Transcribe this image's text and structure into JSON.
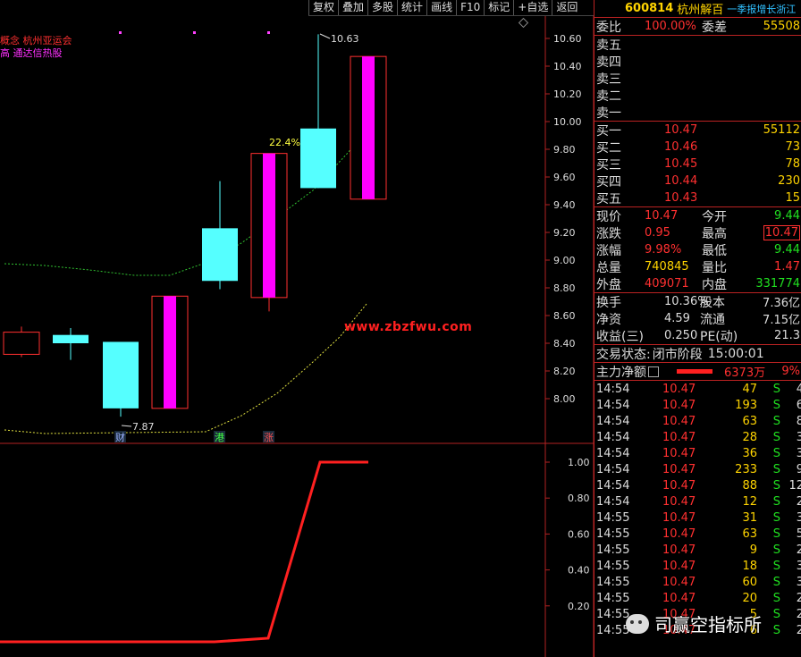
{
  "toolbar": [
    "复权",
    "叠加",
    "多股",
    "统计",
    "画线",
    "F10",
    "标记",
    "+自选",
    "返回"
  ],
  "concepts": [
    {
      "text": "概念 杭州亚运会",
      "color": "#ff3030"
    },
    {
      "text": "高 通达信热股",
      "color": "#ff30ff"
    }
  ],
  "chart_data": {
    "type": "candlestick",
    "y_ticks": [
      "10.60",
      "10.40",
      "10.20",
      "10.00",
      "9.80",
      "9.60",
      "9.40",
      "9.20",
      "9.00",
      "8.80",
      "8.60",
      "8.40",
      "8.20",
      "8.00"
    ],
    "candles": [
      {
        "open": 8.32,
        "close": 8.48,
        "high": 8.52,
        "low": 8.3,
        "color": "#ff3030",
        "fill": "none"
      },
      {
        "open": 8.46,
        "close": 8.4,
        "high": 8.51,
        "low": 8.28,
        "color": "#55ffff",
        "fill": "#55ffff"
      },
      {
        "open": 8.41,
        "close": 7.93,
        "high": 8.41,
        "low": 7.87,
        "color": "#55ffff",
        "fill": "#55ffff"
      },
      {
        "open": 7.93,
        "close": 8.74,
        "high": 8.74,
        "low": 7.93,
        "color": "#ff3030",
        "fill": "#ff00ff"
      },
      {
        "open": 9.23,
        "close": 8.85,
        "high": 9.57,
        "low": 8.79,
        "color": "#55ffff",
        "fill": "#55ffff"
      },
      {
        "open": 8.73,
        "close": 9.77,
        "high": 9.77,
        "low": 8.63,
        "color": "#ff3030",
        "fill": "#ff00ff"
      },
      {
        "open": 9.95,
        "close": 9.52,
        "high": 10.63,
        "low": 9.52,
        "color": "#55ffff",
        "fill": "#55ffff"
      },
      {
        "open": 9.44,
        "close": 10.47,
        "high": 10.47,
        "low": 9.44,
        "color": "#ff3030",
        "fill": "#ff00ff"
      }
    ],
    "annotations": {
      "high": "10.63",
      "low": "7.87",
      "pct": "22.4%"
    },
    "markers": [
      {
        "text": "财",
        "color": "#9ab0ff"
      },
      {
        "text": "港",
        "color": "#40ff40"
      },
      {
        "text": "涨",
        "color": "#ff5050"
      }
    ],
    "lower_y_ticks": [
      "1.00",
      "0.80",
      "0.60",
      "0.40",
      "0.20"
    ],
    "lower_line": [
      0,
      0,
      0,
      0,
      0,
      0.02,
      1,
      1
    ]
  },
  "watermark": "www.zbzfwu.com",
  "header": {
    "code": "600814",
    "name": "杭州解百",
    "ticker": "一季报增长浙江"
  },
  "weibi": {
    "label": "委比",
    "value": "100.00%",
    "label2": "委差",
    "value2": "55508"
  },
  "sell": [
    {
      "label": "卖五"
    },
    {
      "label": "卖四"
    },
    {
      "label": "卖三"
    },
    {
      "label": "卖二"
    },
    {
      "label": "卖一"
    }
  ],
  "buy": [
    {
      "label": "买一",
      "price": "10.47",
      "vol": "55112"
    },
    {
      "label": "买二",
      "price": "10.46",
      "vol": "73"
    },
    {
      "label": "买三",
      "price": "10.45",
      "vol": "78"
    },
    {
      "label": "买四",
      "price": "10.44",
      "vol": "230"
    },
    {
      "label": "买五",
      "price": "10.43",
      "vol": "15"
    }
  ],
  "quote": [
    {
      "l1": "现价",
      "v1": "10.47",
      "c1": "r",
      "l2": "今开",
      "v2": "9.44",
      "c2": "g"
    },
    {
      "l1": "涨跌",
      "v1": "0.95",
      "c1": "r",
      "l2": "最高",
      "v2": "10.47",
      "c2": "r"
    },
    {
      "l1": "涨幅",
      "v1": "9.98%",
      "c1": "r",
      "l2": "最低",
      "v2": "9.44",
      "c2": "g"
    },
    {
      "l1": "总量",
      "v1": "740845",
      "c1": "y",
      "l2": "量比",
      "v2": "1.47",
      "c2": "r"
    },
    {
      "l1": "外盘",
      "v1": "409071",
      "c1": "r",
      "l2": "内盘",
      "v2": "331774",
      "c2": "g"
    }
  ],
  "quote2": [
    {
      "l1": "换手",
      "v1": "10.36%",
      "l2": "股本",
      "v2": "7.36亿"
    },
    {
      "l1": "净资",
      "v1": "4.59",
      "l2": "流通",
      "v2": "7.15亿"
    },
    {
      "l1": "收益(三)",
      "v1": "0.250",
      "l2": "PE(动)",
      "v2": "21.3"
    }
  ],
  "status": {
    "label": "交易状态:",
    "value": "闭市阶段",
    "time": "15:00:01"
  },
  "mainflow": {
    "label": "主力净额",
    "price": "10.47",
    "amount": "6373万",
    "pct": "9%"
  },
  "ticks": [
    {
      "t": "14:54",
      "p": "10.47",
      "v": "47",
      "s": "S",
      "x": "4"
    },
    {
      "t": "14:54",
      "p": "10.47",
      "v": "193",
      "s": "S",
      "x": "6"
    },
    {
      "t": "14:54",
      "p": "10.47",
      "v": "63",
      "s": "S",
      "x": "8"
    },
    {
      "t": "14:54",
      "p": "10.47",
      "v": "28",
      "s": "S",
      "x": "3"
    },
    {
      "t": "14:54",
      "p": "10.47",
      "v": "36",
      "s": "S",
      "x": "3"
    },
    {
      "t": "14:54",
      "p": "10.47",
      "v": "233",
      "s": "S",
      "x": "9"
    },
    {
      "t": "14:54",
      "p": "10.47",
      "v": "88",
      "s": "S",
      "x": "12"
    },
    {
      "t": "14:54",
      "p": "10.47",
      "v": "12",
      "s": "S",
      "x": "2"
    },
    {
      "t": "14:55",
      "p": "10.47",
      "v": "31",
      "s": "S",
      "x": "3"
    },
    {
      "t": "14:55",
      "p": "10.47",
      "v": "63",
      "s": "S",
      "x": "5"
    },
    {
      "t": "14:55",
      "p": "10.47",
      "v": "9",
      "s": "S",
      "x": "2"
    },
    {
      "t": "14:55",
      "p": "10.47",
      "v": "18",
      "s": "S",
      "x": "3"
    },
    {
      "t": "14:55",
      "p": "10.47",
      "v": "60",
      "s": "S",
      "x": "3"
    },
    {
      "t": "14:55",
      "p": "10.47",
      "v": "20",
      "s": "S",
      "x": "2"
    },
    {
      "t": "14:55",
      "p": "10.47",
      "v": "5",
      "s": "S",
      "x": "2"
    },
    {
      "t": "14:55",
      "p": "10.47",
      "v": "6",
      "s": "S",
      "x": "2"
    }
  ],
  "brand": "司赢空指标所",
  "colors": {
    "up": "#ff3030",
    "down": "#55ffff",
    "fill_up": "#ff00ff",
    "grid": "#b22222",
    "ma1": "#30c030",
    "ma2": "#e0e040"
  }
}
